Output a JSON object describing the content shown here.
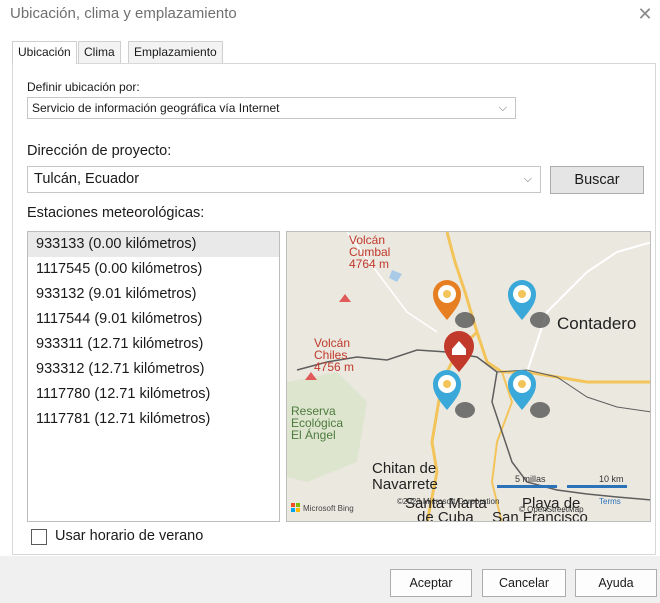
{
  "window": {
    "title": "Ubicación, clima y emplazamiento",
    "close_glyph": "✕"
  },
  "tabs": [
    {
      "label": "Ubicación",
      "active": true
    },
    {
      "label": "Clima",
      "active": false
    },
    {
      "label": "Emplazamiento",
      "active": false
    }
  ],
  "location": {
    "define_label": "Definir ubicación por:",
    "define_value": "Servicio de información geográfica vía Internet",
    "address_label": "Dirección de proyecto:",
    "address_value": "Tulcán, Ecuador",
    "search_label": "Buscar"
  },
  "stations": {
    "label": "Estaciones meteorológicas:",
    "items": [
      "933133 (0.00 kilómetros)",
      "1117545 (0.00 kilómetros)",
      "933132 (9.01 kilómetros)",
      "1117544 (9.01 kilómetros)",
      "933311 (12.71 kilómetros)",
      "933312 (12.71 kilómetros)",
      "1117780 (12.71 kilómetros)",
      "1117781 (12.71 kilómetros)"
    ],
    "selected_index": 0
  },
  "map": {
    "labels": {
      "volcan_cumbal": [
        "Volcán",
        "Cumbal",
        "4764 m"
      ],
      "volcan_chiles": [
        "Volcán",
        "Chiles",
        "4756 m"
      ],
      "reserva": [
        "Reserva",
        "Ecológica",
        "El Ángel"
      ],
      "contadero": "Contadero",
      "chitan": [
        "Chitan de",
        "Navarrete"
      ],
      "bottom_place": "Santa Marta",
      "bottom_place2": "Playa de",
      "bottom_place3": "de Cuba",
      "bottom_place4": "San Francisco"
    },
    "scale_miles": "5 millas",
    "scale_km": "10 km",
    "bing_text": "Microsoft Bing",
    "copyright": "©2023 Microsoft Corporation",
    "osm": "© OpenStreetMap",
    "terms": "Terms",
    "colors": {
      "water": "#a9cbe7",
      "road": "#f3c45a",
      "border": "#666666",
      "pin_weather": "#3aa8d8",
      "pin_home": "#c0392b",
      "pin_orange": "#e67e22"
    }
  },
  "daylight": {
    "label": "Usar horario de verano",
    "checked": false
  },
  "buttons": {
    "ok": "Aceptar",
    "cancel": "Cancelar",
    "help": "Ayuda"
  }
}
